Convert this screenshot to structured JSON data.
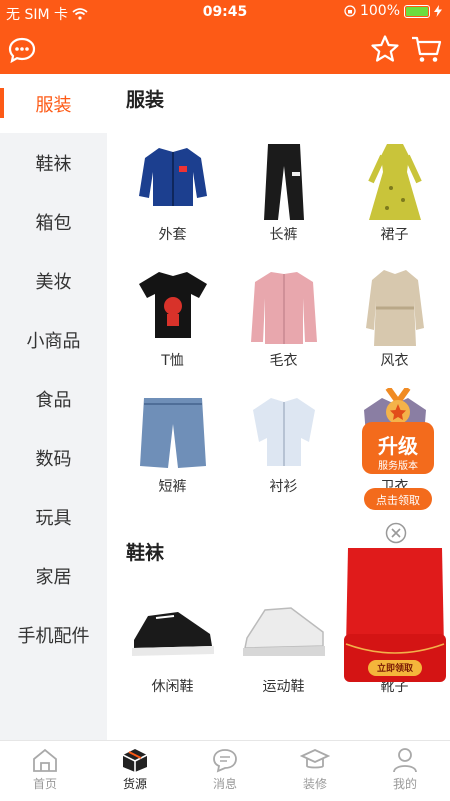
{
  "status": {
    "carrier": "无 SIM 卡",
    "time": "09:45",
    "battery": "100%"
  },
  "header": {
    "icons": [
      "message-icon",
      "star-icon",
      "cart-icon"
    ]
  },
  "sidebar": {
    "items": [
      {
        "label": "服装",
        "active": true
      },
      {
        "label": "鞋袜"
      },
      {
        "label": "箱包"
      },
      {
        "label": "美妆"
      },
      {
        "label": "小商品"
      },
      {
        "label": "食品"
      },
      {
        "label": "数码"
      },
      {
        "label": "玩具"
      },
      {
        "label": "家居"
      },
      {
        "label": "手机配件"
      }
    ]
  },
  "main": {
    "sections": [
      {
        "title": "服装",
        "items": [
          "外套",
          "长裤",
          "裙子",
          "T恤",
          "毛衣",
          "风衣",
          "短裤",
          "衬衫",
          "卫衣"
        ]
      },
      {
        "title": "鞋袜",
        "items": [
          "休闲鞋",
          "运动鞋",
          "靴子"
        ]
      }
    ]
  },
  "promo": {
    "upgrade_title": "升级",
    "upgrade_sub": "服务版本",
    "claim_button": "点击领取",
    "bag_button": "立即领取"
  },
  "tabs": [
    {
      "label": "首页"
    },
    {
      "label": "货源",
      "active": true
    },
    {
      "label": "消息"
    },
    {
      "label": "装修"
    },
    {
      "label": "我的"
    }
  ],
  "colors": {
    "brand": "#fd5a16",
    "sidebar_bg": "#f2f3f5"
  }
}
